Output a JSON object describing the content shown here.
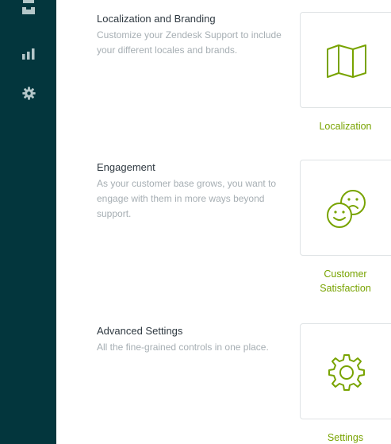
{
  "sidebar": {
    "items": [
      {
        "icon": "tray-icon"
      },
      {
        "icon": "bar-chart-icon"
      },
      {
        "icon": "gear-icon"
      }
    ],
    "background": "#03363d",
    "icon_color": "#b4c7c9"
  },
  "sections": [
    {
      "title": "Localization and Branding",
      "description": "Customize your Zendesk Support to include your different locales and brands.",
      "card_icon": "map-icon",
      "card_label": "Localization"
    },
    {
      "title": "Engagement",
      "description": "As your customer base grows, you want to engage with them in more ways beyond support.",
      "card_icon": "smiley-faces-icon",
      "card_label": "Customer Satisfaction"
    },
    {
      "title": "Advanced Settings",
      "description": "All the fine-grained controls in one place.",
      "card_icon": "gear-icon",
      "card_label": "Settings"
    }
  ],
  "colors": {
    "accent": "#78a300",
    "title_text": "#2f3941",
    "description_text": "#a6aeb3",
    "card_border": "#dfe3e5"
  }
}
